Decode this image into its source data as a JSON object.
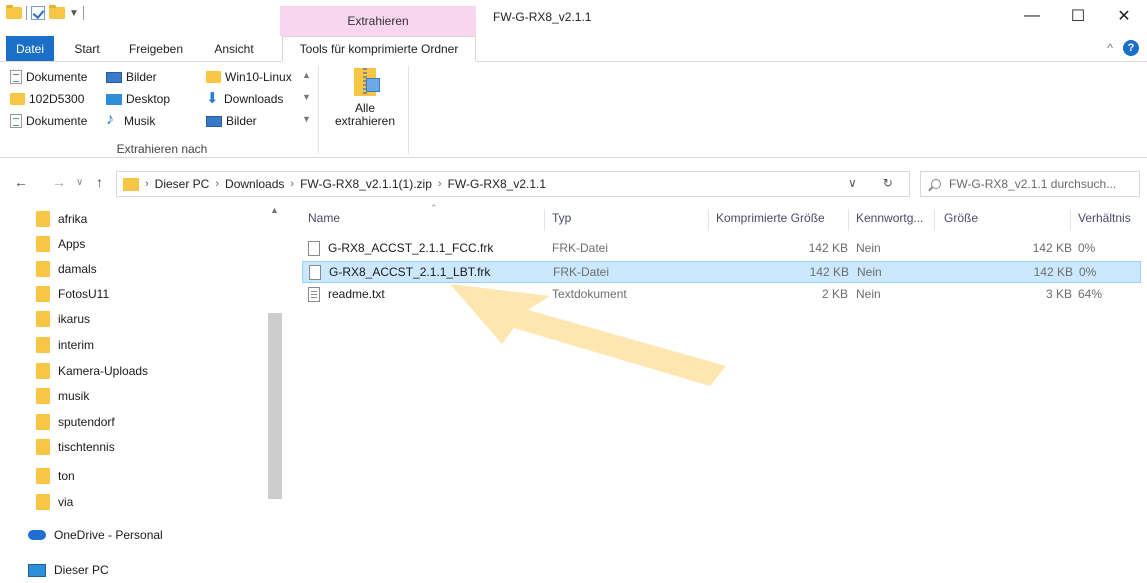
{
  "window": {
    "title": "FW-G-RX8_v2.1.1",
    "context_tab_header": "Extrahieren",
    "minimize_glyph": "—",
    "maximize_glyph": "☐",
    "close_glyph": "✕"
  },
  "ribbon_tabs": {
    "file": "Datei",
    "start": "Start",
    "share": "Freigeben",
    "view": "Ansicht",
    "tools": "Tools für komprimierte Ordner",
    "collapse_glyph": "^",
    "help_glyph": "?"
  },
  "extract_to": {
    "items": [
      {
        "label": "Dokumente",
        "icon": "document-icon"
      },
      {
        "label": "Bilder",
        "icon": "pictures-icon"
      },
      {
        "label": "Win10-Linux",
        "icon": "folder-icon"
      },
      {
        "label": "102D5300",
        "icon": "folder-icon"
      },
      {
        "label": "Desktop",
        "icon": "desktop-icon"
      },
      {
        "label": "Downloads",
        "icon": "download-icon"
      },
      {
        "label": "Dokumente",
        "icon": "document-icon"
      },
      {
        "label": "Musik",
        "icon": "music-icon"
      },
      {
        "label": "Bilder",
        "icon": "pictures-icon"
      }
    ],
    "group_label": "Extrahieren nach"
  },
  "extract_all": {
    "label_line1": "Alle",
    "label_line2": "extrahieren"
  },
  "address": {
    "back": "←",
    "forward": "→",
    "recent": "∨",
    "up": "↑",
    "crumbs": [
      "Dieser PC",
      "Downloads",
      "FW-G-RX8_v2.1.1(1).zip",
      "FW-G-RX8_v2.1.1"
    ],
    "separator": "›",
    "history_dropdown": "∨",
    "refresh": "↻",
    "search_placeholder": "FW-G-RX8_v2.1.1 durchsuch..."
  },
  "nav_pane": {
    "folders": [
      "afrika",
      "Apps",
      "damals",
      "FotosU11",
      "ikarus",
      "interim",
      "Kamera-Uploads",
      "musik",
      "sputendorf",
      "tischtennis",
      "ton",
      "via"
    ],
    "onedrive": "OneDrive - Personal",
    "this_pc": "Dieser PC"
  },
  "file_list": {
    "columns": {
      "name": "Name",
      "type": "Typ",
      "compressed": "Komprimierte Größe",
      "password": "Kennwortg...",
      "size": "Größe",
      "ratio": "Verhältnis"
    },
    "rows": [
      {
        "name": "G-RX8_ACCST_2.1.1_FCC.frk",
        "type": "FRK-Datei",
        "compressed": "142 KB",
        "password": "Nein",
        "size": "142 KB",
        "ratio": "0%",
        "selected": false
      },
      {
        "name": "G-RX8_ACCST_2.1.1_LBT.frk",
        "type": "FRK-Datei",
        "compressed": "142 KB",
        "password": "Nein",
        "size": "142 KB",
        "ratio": "0%",
        "selected": true
      },
      {
        "name": "readme.txt",
        "type": "Textdokument",
        "compressed": "2 KB",
        "password": "Nein",
        "size": "3 KB",
        "ratio": "64%",
        "selected": false
      }
    ]
  },
  "colors": {
    "file_tab": "#1a6fc7",
    "context_tab": "#f9d6f0",
    "selection_bg": "#cce8ff",
    "selection_border": "#99d1ff",
    "arrow": "#fde3a7"
  }
}
